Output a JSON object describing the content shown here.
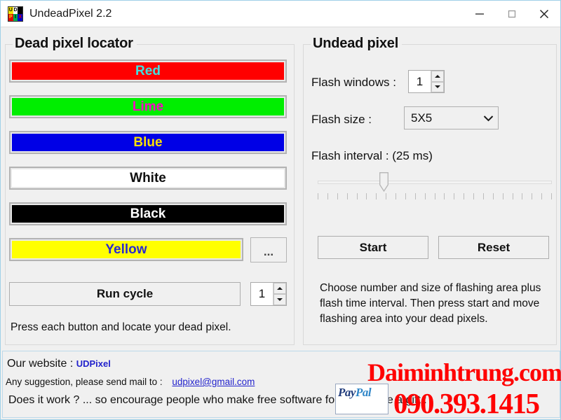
{
  "window": {
    "title": "UndeadPixel 2.2",
    "icon_name": "undeadpixel-app-icon",
    "icon_cells": [
      "U",
      "D",
      " ",
      "P",
      "I",
      "X"
    ],
    "minimize_label": "–",
    "maximize_label": "□",
    "close_label": "✕"
  },
  "left_panel": {
    "title": "Dead pixel locator",
    "buttons": [
      {
        "label": "Red",
        "bg": "#ff0000",
        "fg": "#40e0e0"
      },
      {
        "label": "Lime",
        "bg": "#00ee00",
        "fg": "#ff00c8"
      },
      {
        "label": "Blue",
        "bg": "#0000e6",
        "fg": "#ffe000"
      },
      {
        "label": "White",
        "bg": "#ffffff",
        "fg": "#101010"
      },
      {
        "label": "Black",
        "bg": "#000000",
        "fg": "#ffffff"
      },
      {
        "label": "Yellow",
        "bg": "#ffff00",
        "fg": "#2a2ad0"
      }
    ],
    "more_colors_label": "...",
    "run_cycle_label": "Run cycle",
    "cycle_count": "1",
    "hint": "Press each button and locate your dead pixel."
  },
  "right_panel": {
    "title": "Undead pixel",
    "flash_windows_label": "Flash windows :",
    "flash_windows_value": "1",
    "flash_size_label": "Flash size :",
    "flash_size_value": "5X5",
    "flash_interval_label": "Flash interval :  (25 ms)",
    "slider_ticks": 25,
    "slider_thumb_percent": 28,
    "start_label": "Start",
    "reset_label": "Reset",
    "description_line1": "Choose number and size of flashing area plus",
    "description_line2": "flash time interval. Then press start and move",
    "description_line3": "flashing area into your dead pixels."
  },
  "footer": {
    "website_label": "Our website :",
    "website_link": "UDPixel",
    "mail_label": "Any suggestion, please send mail to :",
    "mail_link": "udpixel@gmail.com",
    "gift_text": "Does it work ? ... so encourage people who make free software for you, make a gift :",
    "paypal_word1": "Pay",
    "paypal_word2": "Pal"
  },
  "watermark": {
    "site": "Daiminhtrung.com",
    "phone": "090.393.1415",
    "color": "#ff0000"
  }
}
